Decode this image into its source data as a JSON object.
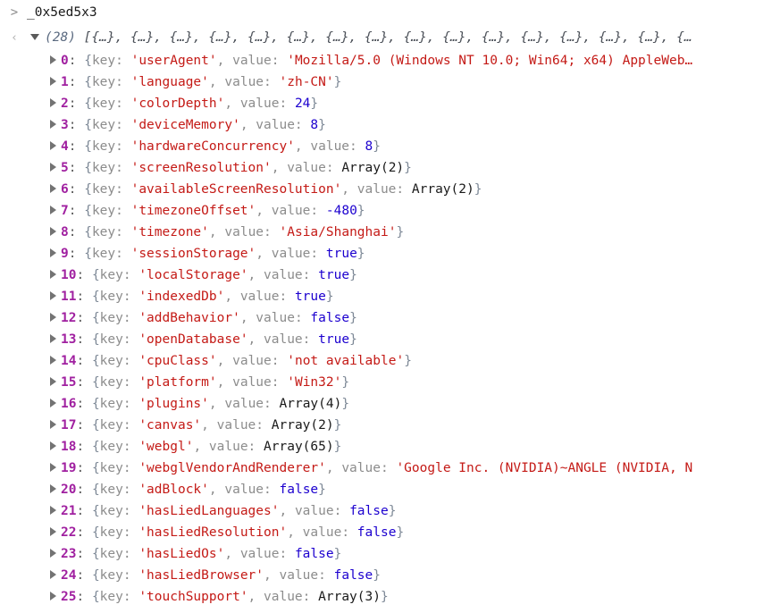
{
  "console": {
    "background_color": "#ffffff",
    "command": {
      "prompt_icon": "angle-right",
      "prompt_glyph": ">",
      "text": "_0x5ed5x3"
    },
    "result": {
      "return_icon": "return-arrow",
      "return_glyph": "‹",
      "expanded": true,
      "count_label": "(28)",
      "preview": "[{…}, {…}, {…}, {…}, {…}, {…}, {…}, {…}, {…}, {…}, {…}, {…}, {…}, {…}, {…}, {…",
      "truncated": true
    },
    "colors": {
      "string": "#c41a16",
      "number": "#1c00cf",
      "boolean": "#1c00cf",
      "index": "#a020a0",
      "object_key": "#8c8c8c",
      "punctuation": "#7d8896",
      "plain": "#1a1a1a"
    },
    "syntax": {
      "open_brace": "{",
      "close_brace": "}",
      "key_label": "key:",
      "value_label": "value:",
      "comma": ",",
      "quote": "'"
    },
    "entries": [
      {
        "index": "0",
        "key": "userAgent",
        "value": "Mozilla/5.0 (Windows NT 10.0; Win64; x64) AppleWeb…",
        "type": "string",
        "closed": false
      },
      {
        "index": "1",
        "key": "language",
        "value": "zh-CN",
        "type": "string",
        "closed": true
      },
      {
        "index": "2",
        "key": "colorDepth",
        "value": "24",
        "type": "number",
        "closed": true
      },
      {
        "index": "3",
        "key": "deviceMemory",
        "value": "8",
        "type": "number",
        "closed": true
      },
      {
        "index": "4",
        "key": "hardwareConcurrency",
        "value": "8",
        "type": "number",
        "closed": true
      },
      {
        "index": "5",
        "key": "screenResolution",
        "value": "Array(2)",
        "type": "plain",
        "closed": true
      },
      {
        "index": "6",
        "key": "availableScreenResolution",
        "value": "Array(2)",
        "type": "plain",
        "closed": true
      },
      {
        "index": "7",
        "key": "timezoneOffset",
        "value": "-480",
        "type": "number",
        "closed": true
      },
      {
        "index": "8",
        "key": "timezone",
        "value": "Asia/Shanghai",
        "type": "string",
        "closed": true
      },
      {
        "index": "9",
        "key": "sessionStorage",
        "value": "true",
        "type": "boolean",
        "closed": true
      },
      {
        "index": "10",
        "key": "localStorage",
        "value": "true",
        "type": "boolean",
        "closed": true
      },
      {
        "index": "11",
        "key": "indexedDb",
        "value": "true",
        "type": "boolean",
        "closed": true
      },
      {
        "index": "12",
        "key": "addBehavior",
        "value": "false",
        "type": "boolean",
        "closed": true
      },
      {
        "index": "13",
        "key": "openDatabase",
        "value": "true",
        "type": "boolean",
        "closed": true
      },
      {
        "index": "14",
        "key": "cpuClass",
        "value": "not available",
        "type": "string",
        "closed": true
      },
      {
        "index": "15",
        "key": "platform",
        "value": "Win32",
        "type": "string",
        "closed": true
      },
      {
        "index": "16",
        "key": "plugins",
        "value": "Array(4)",
        "type": "plain",
        "closed": true
      },
      {
        "index": "17",
        "key": "canvas",
        "value": "Array(2)",
        "type": "plain",
        "closed": true
      },
      {
        "index": "18",
        "key": "webgl",
        "value": "Array(65)",
        "type": "plain",
        "closed": true
      },
      {
        "index": "19",
        "key": "webglVendorAndRenderer",
        "value": "Google Inc. (NVIDIA)~ANGLE (NVIDIA, N",
        "type": "string",
        "closed": false
      },
      {
        "index": "20",
        "key": "adBlock",
        "value": "false",
        "type": "boolean",
        "closed": true
      },
      {
        "index": "21",
        "key": "hasLiedLanguages",
        "value": "false",
        "type": "boolean",
        "closed": true
      },
      {
        "index": "22",
        "key": "hasLiedResolution",
        "value": "false",
        "type": "boolean",
        "closed": true
      },
      {
        "index": "23",
        "key": "hasLiedOs",
        "value": "false",
        "type": "boolean",
        "closed": true
      },
      {
        "index": "24",
        "key": "hasLiedBrowser",
        "value": "false",
        "type": "boolean",
        "closed": true
      },
      {
        "index": "25",
        "key": "touchSupport",
        "value": "Array(3)",
        "type": "plain",
        "closed": true
      }
    ]
  }
}
